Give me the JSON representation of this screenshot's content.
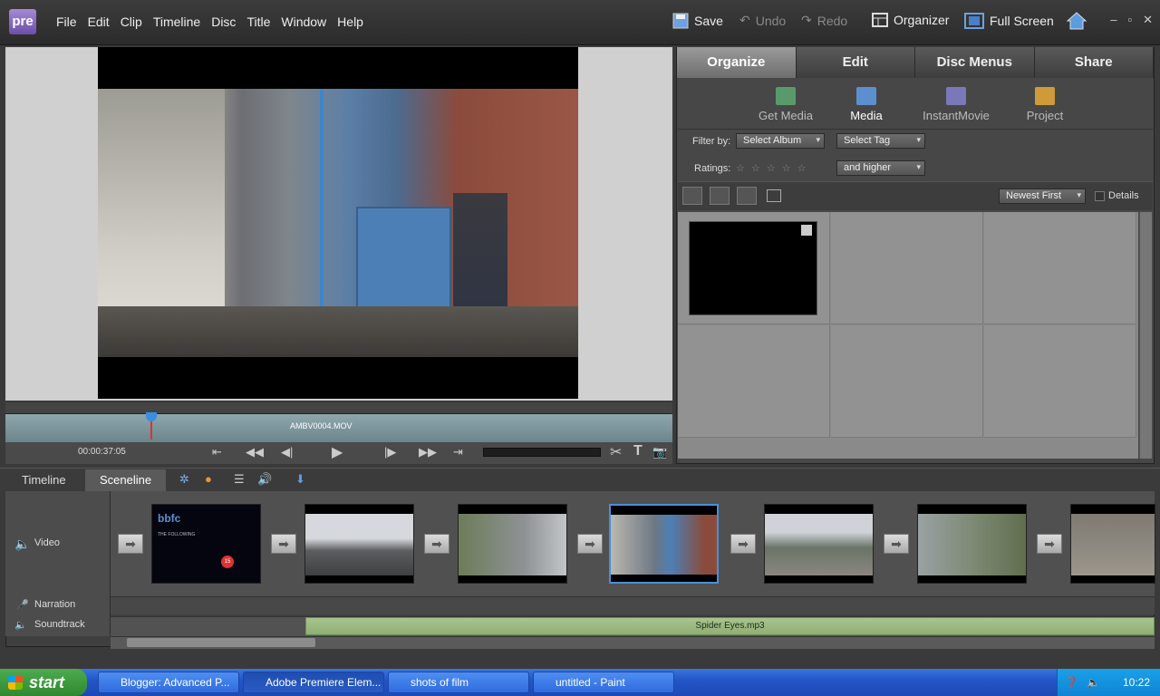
{
  "app": {
    "logo": "pre"
  },
  "menu": [
    "File",
    "Edit",
    "Clip",
    "Timeline",
    "Disc",
    "Title",
    "Window",
    "Help"
  ],
  "toolbar": {
    "save": "Save",
    "undo": "Undo",
    "redo": "Redo",
    "organizer": "Organizer",
    "fullscreen": "Full Screen"
  },
  "monitor": {
    "clip_name": "AMBV0004.MOV",
    "timecode": "00:00:37:05"
  },
  "right_panel": {
    "tabs": [
      "Organize",
      "Edit",
      "Disc Menus",
      "Share"
    ],
    "active_tab": "Organize",
    "subtabs": [
      "Get Media",
      "Media",
      "InstantMovie",
      "Project"
    ],
    "active_subtab": "Media",
    "filter_label": "Filter by:",
    "album_select": "Select Album",
    "tag_select": "Select Tag",
    "ratings_label": "Ratings:",
    "ratings_stars": "☆ ☆ ☆ ☆ ☆",
    "rating_select": "and higher",
    "sort_select": "Newest First",
    "details_label": "Details"
  },
  "timeline": {
    "tabs": [
      "Timeline",
      "Sceneline"
    ],
    "active_tab": "Sceneline",
    "tracks": {
      "video": "Video",
      "narration": "Narration",
      "soundtrack": "Soundtrack"
    },
    "music_clip": "Spider Eyes.mp3",
    "thumb_credit": {
      "title": "THE FOLLOWING",
      "rating": "15",
      "brand": "bbfc"
    }
  },
  "taskbar": {
    "start": "start",
    "tasks": [
      "Blogger: Advanced P...",
      "Adobe Premiere Elem...",
      "shots of film",
      "untitled - Paint"
    ],
    "clock": "10:22"
  },
  "colors": {
    "accent": "#4a8fd8",
    "music": "#9bbd80",
    "taskbar": "#245edc"
  }
}
